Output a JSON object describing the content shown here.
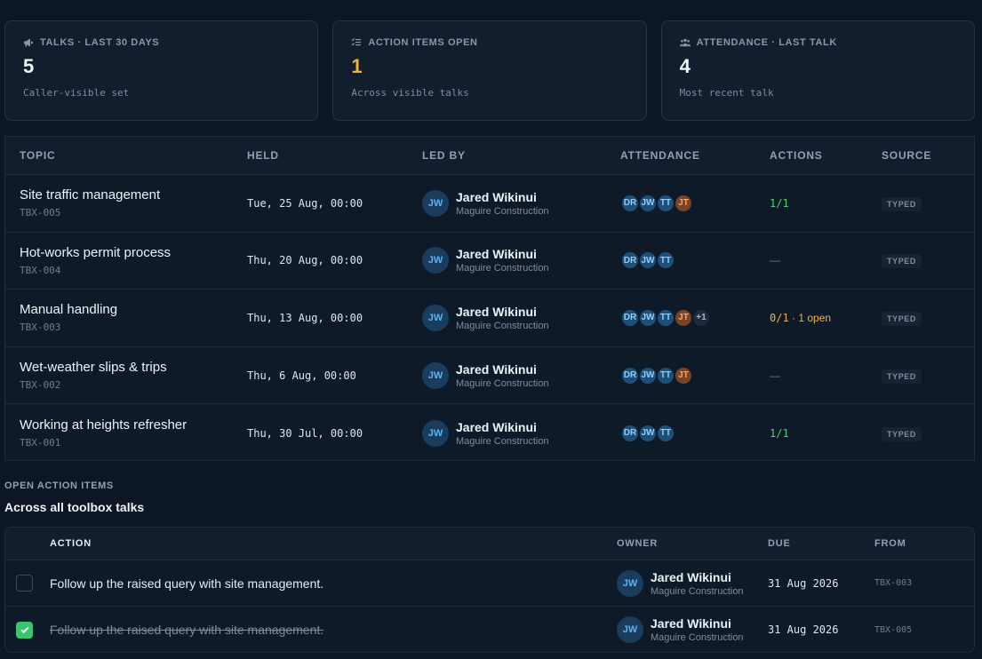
{
  "stats": [
    {
      "label": "TALKS · LAST 30 DAYS",
      "value": "5",
      "sub": "Caller-visible set",
      "icon": "megaphone-icon"
    },
    {
      "label": "ACTION ITEMS OPEN",
      "value": "1",
      "sub": "Across visible talks",
      "icon": "checklist-icon"
    },
    {
      "label": "ATTENDANCE · LAST TALK",
      "value": "4",
      "sub": "Most recent talk",
      "icon": "people-icon"
    }
  ],
  "talks": {
    "headers": {
      "topic": "TOPIC",
      "held": "HELD",
      "led_by": "LED BY",
      "attendance": "ATTENDANCE",
      "actions": "ACTIONS",
      "source": "SOURCE"
    },
    "rows": [
      {
        "title": "Site traffic management",
        "id": "TBX-005",
        "held": "Tue, 25 Aug, 00:00",
        "leader_initials": "JW",
        "leader": "Jared Wikinui",
        "org": "Maguire Construction",
        "attendees": [
          "DR",
          "JW",
          "TT",
          "JT"
        ],
        "more": "",
        "actions": "1/1",
        "actions_note": "",
        "source": "TYPED"
      },
      {
        "title": "Hot-works permit process",
        "id": "TBX-004",
        "held": "Thu, 20 Aug, 00:00",
        "leader_initials": "JW",
        "leader": "Jared Wikinui",
        "org": "Maguire Construction",
        "attendees": [
          "DR",
          "JW",
          "TT"
        ],
        "more": "",
        "actions": "—",
        "actions_note": "",
        "source": "TYPED"
      },
      {
        "title": "Manual handling",
        "id": "TBX-003",
        "held": "Thu, 13 Aug, 00:00",
        "leader_initials": "JW",
        "leader": "Jared Wikinui",
        "org": "Maguire Construction",
        "attendees": [
          "DR",
          "JW",
          "TT",
          "JT"
        ],
        "more": "+1",
        "actions": "0/1",
        "actions_note": " · 1 open",
        "source": "TYPED"
      },
      {
        "title": "Wet-weather slips & trips",
        "id": "TBX-002",
        "held": "Thu, 6 Aug, 00:00",
        "leader_initials": "JW",
        "leader": "Jared Wikinui",
        "org": "Maguire Construction",
        "attendees": [
          "DR",
          "JW",
          "TT",
          "JT"
        ],
        "more": "",
        "actions": "—",
        "actions_note": "",
        "source": "TYPED"
      },
      {
        "title": "Working at heights refresher",
        "id": "TBX-001",
        "held": "Thu, 30 Jul, 00:00",
        "leader_initials": "JW",
        "leader": "Jared Wikinui",
        "org": "Maguire Construction",
        "attendees": [
          "DR",
          "JW",
          "TT"
        ],
        "more": "",
        "actions": "1/1",
        "actions_note": "",
        "source": "TYPED"
      }
    ]
  },
  "open_actions": {
    "section_label": "OPEN ACTION ITEMS",
    "title": "Across all toolbox talks",
    "headers": {
      "action": "ACTION",
      "owner": "OWNER",
      "due": "DUE",
      "from": "FROM"
    },
    "rows": [
      {
        "done": false,
        "text": "Follow up the raised query with site management.",
        "owner_initials": "JW",
        "owner": "Jared Wikinui",
        "org": "Maguire Construction",
        "due": "31 Aug 2026",
        "from": "TBX-003"
      },
      {
        "done": true,
        "text": "Follow up the raised query with site management.",
        "owner_initials": "JW",
        "owner": "Jared Wikinui",
        "org": "Maguire Construction",
        "due": "31 Aug 2026",
        "from": "TBX-005"
      }
    ]
  },
  "colors": {
    "background": "#0c1624",
    "accent_blue": "#58b3f2",
    "amber": "#f2b234",
    "green": "#4fd17b"
  }
}
